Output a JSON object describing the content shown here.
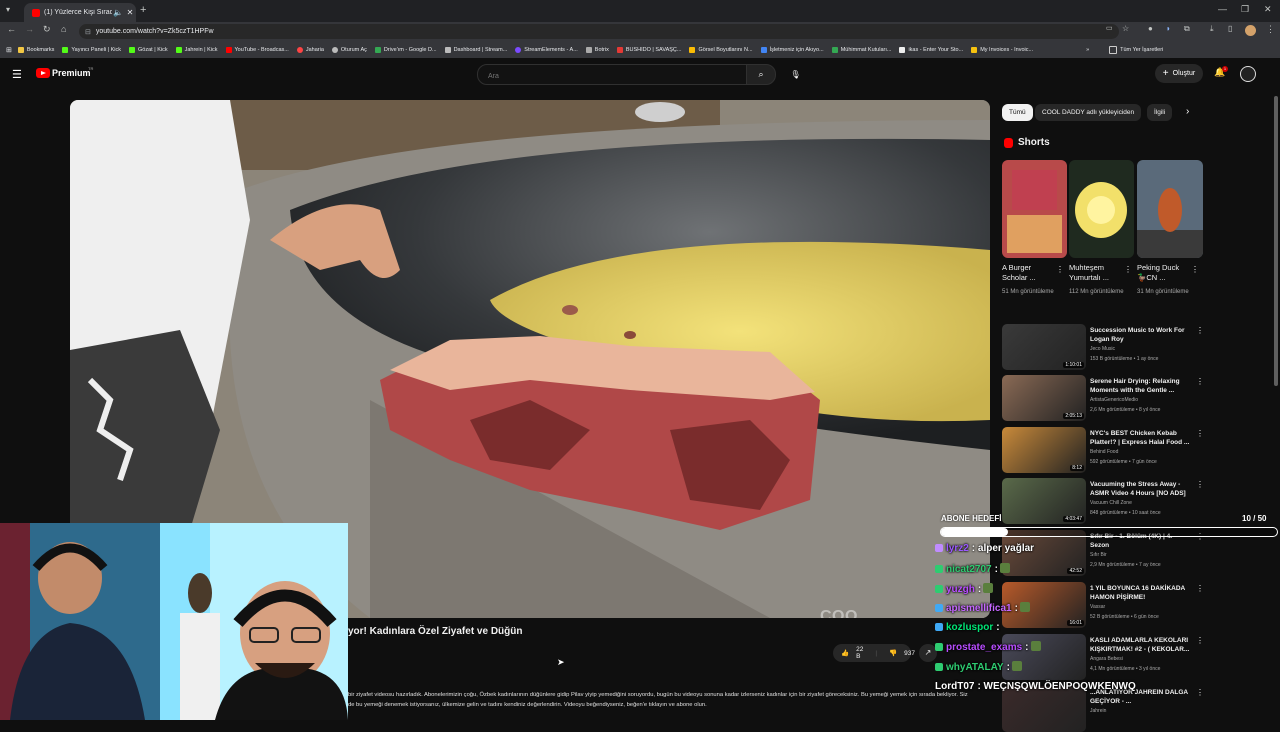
{
  "browser": {
    "tab_title": "(1) Yüzlerce Kişi Sıradal!! H",
    "url": "youtube.com/watch?v=Zk5czT1HPFw",
    "bookmarks": [
      "Bookmarks",
      "Yayıncı Paneli | Kick",
      "Gözat | Kick",
      "Jahrein | Kick",
      "YouTube - Broadcas...",
      "Jaharia",
      "Oturum Aç",
      "Drive'ım - Google D...",
      "Dashboard | Stream...",
      "StreamElements - A...",
      "Botrix",
      "BUSHIDO | SAVAŞÇ...",
      "Görsel Boyutlarını N...",
      "İşletmeniz için Akıyo...",
      "Mühimmat Kutuları...",
      "ikas - Enter Your Sto...",
      "My Invoices - Invoic..."
    ],
    "all_bookmarks": "Tüm Yer İşaretleri"
  },
  "youtube": {
    "logo_text": "Premium",
    "region": "TR",
    "search_placeholder": "Ara",
    "create_label": "Oluştur",
    "notif_count": "1"
  },
  "video": {
    "title": "yor! Kadınlara Özel Ziyafet ve Düğün",
    "watermark": "COO",
    "likes": "22 B",
    "dislikes": "937",
    "description": "bir ziyafet videosu hazırladık. Abonelerimizin çoğu, Özbek kadınlarının düğünlere gidip Pilav yiyip yemediğini soruyordu, bugün bu videoyu sonuna kadar izlerseniz kadınlar için bir ziyafet göreceksiniz. Bu yemeği yemek için sırada bekliyor. Siz de bu yemeği denemek istiyorsanız, ülkemize gelin ve tadını kendiniz değerlendirin. Videoyu beğendiyseniz, beğen'e tıklayın ve abone olun."
  },
  "sidebar": {
    "chips": [
      "Tümü",
      "COOL DADDY adlı yükleyiciden",
      "İlgili"
    ],
    "shorts_label": "Shorts",
    "shorts": [
      {
        "title": "A Burger Scholar ...",
        "views": "51 Mn görüntüleme"
      },
      {
        "title": "Muhteşem Yumurtalı ...",
        "views": "112 Mn görüntüleme"
      },
      {
        "title": "Peking Duck 🦆CN ...",
        "views": "31 Mn görüntüleme"
      }
    ],
    "recommendations": [
      {
        "title": "Succession Music to Work For Logan Roy",
        "channel": "Jeco Music",
        "meta": "153 B görüntüleme • 1 ay önce",
        "duration": "1:10:01",
        "color": "#3a3a3a"
      },
      {
        "title": "Serene Hair Drying: Relaxing Moments with the Gentle ...",
        "channel": "ArtistaGenericoMedio",
        "meta": "2,6 Mn görüntüleme • 8 yıl önce",
        "duration": "2:05:13",
        "color": "#8a6a55"
      },
      {
        "title": "NYC's BEST Chicken Kebab Platter!? | Express Halal Food ...",
        "channel": "Behind Food",
        "meta": "592 görüntüleme • 7 gün önce",
        "duration": "8:12",
        "color": "#c98a3a"
      },
      {
        "title": "Vacuuming the Stress Away - ASMR Video 4 Hours [NO ADS]",
        "channel": "Vacuum Chill Zone",
        "meta": "848 görüntüleme • 10 saat önce",
        "duration": "4:03:47",
        "color": "#5a6a4a"
      },
      {
        "title": "Sıfır Bir - 1. Bölüm (4K) | 4. Sezon",
        "channel": "Sıfır Bir",
        "meta": "2,9 Mn görüntüleme • 7 ay önce",
        "duration": "42:52",
        "color": "#6a4a3a"
      },
      {
        "title": "1 YIL BOYUNCA 16 DAKİKADA HAMON PİŞİRME!",
        "channel": "Vassar",
        "meta": "52 B görüntüleme • 6 gün önce",
        "duration": "16:01",
        "color": "#b85a2a"
      },
      {
        "title": "KASLI ADAMLARLA KEKOLARI KIŞKIRTMAK! #2 - ( KEKOLAR...",
        "channel": "Angara Bebesi",
        "meta": "4,1 Mn görüntüleme • 3 yıl önce",
        "duration": "",
        "color": "#4a4a5a"
      },
      {
        "title": "...ANLATIYOR JAHREIN DALGA GEÇİYOR - ...",
        "channel": "Jahrein",
        "meta": "",
        "duration": "",
        "color": "#3a2a2a"
      }
    ]
  },
  "overlay": {
    "goal_label": "ABONE HEDEFİ",
    "goal_count": "10 / 50",
    "goal_fraction": 0.2,
    "chat": [
      {
        "name": "lyrz2",
        "msg": ": alper yağlar",
        "color": "#9b59ff",
        "badge": "#c08cff"
      },
      {
        "name": "nicat2707",
        "msg": ":",
        "color": "#2ecc71",
        "badge": "#2ecc71",
        "emote": true
      },
      {
        "name": "yuzgh",
        "msg": ":",
        "color": "#b84dff",
        "badge": "#2ecc71",
        "emote": true
      },
      {
        "name": "apismellifica1",
        "msg": ":",
        "color": "#c467ff",
        "badge": "#3fa9f5",
        "emote": true
      },
      {
        "name": "kozluspor",
        "msg": ":",
        "color": "#00e676",
        "badge": "#3fa9f5",
        "emote": false
      },
      {
        "name": "prostate_exams",
        "msg": ":",
        "color": "#b84dff",
        "badge": "#2ecc71",
        "emote": true
      },
      {
        "name": "whyATALAY",
        "msg": ":",
        "color": "#2ecc71",
        "badge": "#2ecc71",
        "emote": true
      },
      {
        "name": "LordT07",
        "msg": ": WEÇNŞQWLÖENPOQWKENWQ",
        "color": "#ffffff",
        "badge": "",
        "emote": false
      }
    ]
  }
}
